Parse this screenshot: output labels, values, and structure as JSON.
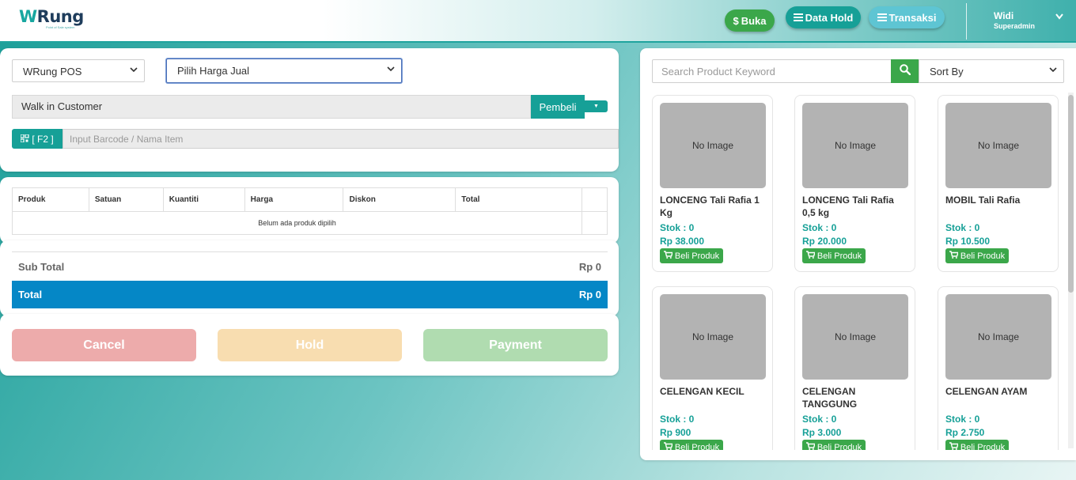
{
  "header": {
    "logo_text_w": "W",
    "logo_text_rest": "Rung",
    "logo_tagline": "Point of Sale system",
    "buka_label": "Buka",
    "data_hold_label": "Data Hold",
    "transaksi_label": "Transaksi",
    "user_name": "Widi",
    "user_role": "Superadmin"
  },
  "form": {
    "outlet_select": "WRung POS",
    "harga_select": "Pilih Harga Jual",
    "customer_value": "Walk in Customer",
    "pembeli_label": "Pembeli",
    "f2_label": "[ F2 ]",
    "barcode_placeholder": "Input Barcode / Nama Item"
  },
  "table": {
    "columns": [
      "Produk",
      "Satuan",
      "Kuantiti",
      "Harga",
      "Diskon",
      "Total"
    ],
    "empty_message": "Belum ada produk dipilih"
  },
  "totals": {
    "sub_total_label": "Sub Total",
    "sub_total_value": "Rp 0",
    "total_label": "Total",
    "total_value": "Rp 0"
  },
  "actions": {
    "cancel_label": "Cancel",
    "hold_label": "Hold",
    "payment_label": "Payment"
  },
  "catalog": {
    "search_placeholder": "Search Product Keyword",
    "sort_label": "Sort By",
    "no_image_label": "No Image",
    "beli_label": "Beli Produk",
    "products": [
      {
        "name": "LONCENG Tali Rafia 1 Kg",
        "stok": "Stok : 0",
        "price": "Rp 38.000"
      },
      {
        "name": "LONCENG Tali Rafia 0,5 kg",
        "stok": "Stok : 0",
        "price": "Rp 20.000"
      },
      {
        "name": "MOBIL Tali Rafia",
        "stok": "Stok : 0",
        "price": "Rp 10.500"
      },
      {
        "name": "CELENGAN KECIL",
        "stok": "Stok : 0",
        "price": "Rp 900"
      },
      {
        "name": "CELENGAN TANGGUNG",
        "stok": "Stok : 0",
        "price": "Rp 3.000"
      },
      {
        "name": "CELENGAN AYAM",
        "stok": "Stok : 0",
        "price": "Rp 2.750"
      }
    ]
  },
  "colors": {
    "teal": "#16a097",
    "green": "#3ba74a",
    "blue_total": "#0587c6"
  }
}
